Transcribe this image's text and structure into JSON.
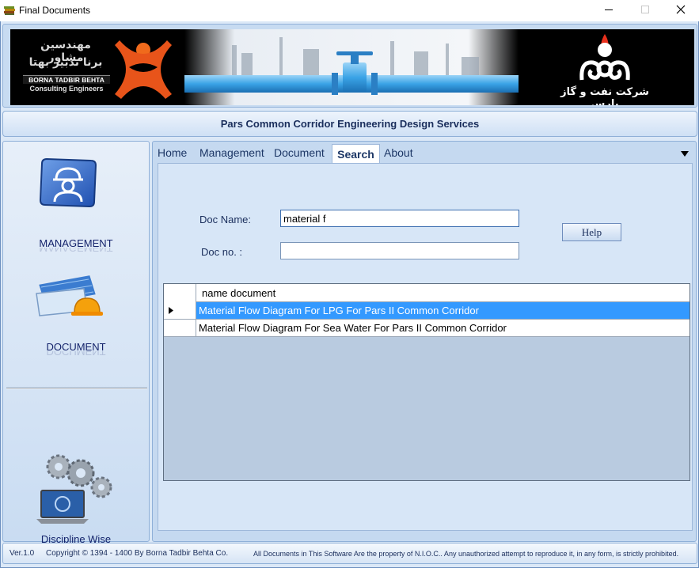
{
  "window": {
    "title": "Final Documents",
    "app_icon": "books-icon",
    "controls": [
      "minimize-icon",
      "maximize-icon",
      "close-icon"
    ]
  },
  "banner": {
    "left_logo_text_fa_1": "مهندسین مشاور",
    "left_logo_text_fa_2": "برنا تدبیر بهتا",
    "left_logo_text_en_1": "BORNA TADBIR BEHTA",
    "left_logo_text_en_2": "Consulting Engineers",
    "right_logo_text": "شرکت نفت و گاز پارس"
  },
  "project_title": "Pars Common Corridor Engineering Design Services",
  "sidebar": {
    "items": [
      {
        "label": "MANAGEMENT",
        "icon": "engineer-icon"
      },
      {
        "label": "DOCUMENT",
        "icon": "blueprint-helmet-icon"
      },
      {
        "label": "Discipline Wise",
        "icon": "gears-laptop-icon"
      }
    ]
  },
  "tabs": {
    "items": [
      "Home",
      "Management",
      "Document",
      "Search",
      "About"
    ],
    "active": "Search",
    "dropdown_icon": "triangle-down-icon"
  },
  "search": {
    "doc_name_label": "Doc Name:",
    "doc_name_value": "material f",
    "doc_no_label": "Doc no. :",
    "doc_no_value": "",
    "help_label": "Help"
  },
  "results": {
    "column_header": "name document",
    "rows": [
      "Material Flow Diagram For LPG For Pars II Common Corridor",
      "Material Flow Diagram For Sea Water For Pars II Common Corridor"
    ],
    "selected_row": 0,
    "current_row_icon": "row-pointer-icon"
  },
  "status": {
    "version": "Ver.1.0",
    "copyright": "Copyright © 1394 - 1400  By  Borna Tadbir Behta Co.",
    "notice": "All Documents in This Software Are the property of N.I.O.C.. Any unauthorized attempt to reproduce it, in any form, is strictly prohibited."
  },
  "colors": {
    "selection": "#3399ff",
    "panel": "#c5d9f0",
    "nav_text": "#14236b",
    "banner_bg": "#000000",
    "pipe": "#4fb0ec"
  }
}
